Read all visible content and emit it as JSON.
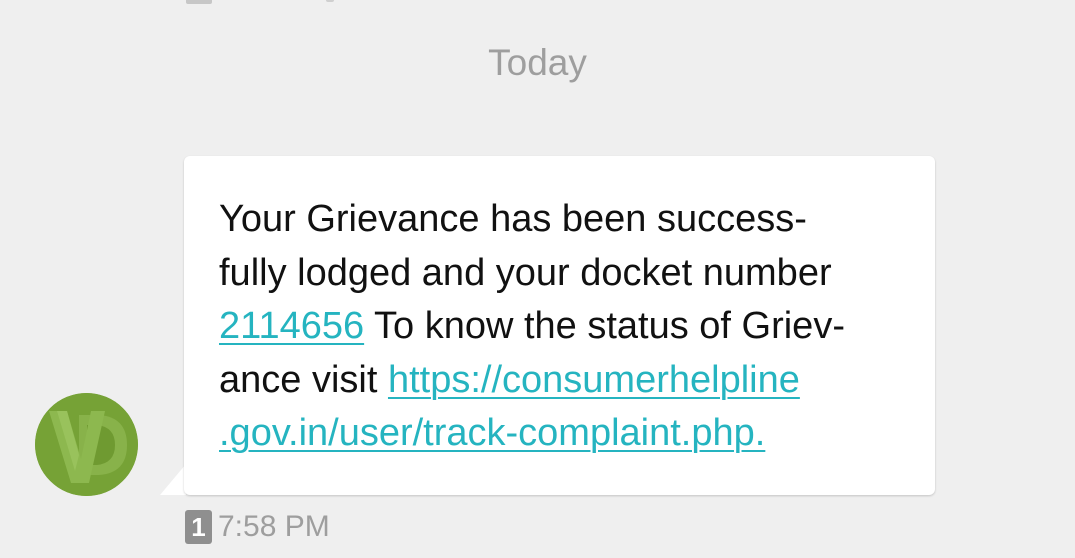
{
  "conversation": {
    "date_divider": "Today"
  },
  "message": {
    "text_line1": "Your Grievance has been success-",
    "text_line2": "fully lodged and your docket number",
    "docket_number": "2114656",
    "text_line3_rest": " To know the status of Griev-",
    "text_line4_prefix": "ance visit ",
    "link_part1": "https://consumerhelpline",
    "link_part2": ".gov.in/user/track-complaint.php.",
    "sim_slot": "1",
    "timestamp": "7:58 PM"
  },
  "sender": {
    "avatar_icon": "vd-logo-icon",
    "avatar_color": "#76a236"
  },
  "colors": {
    "background": "#efefef",
    "bubble": "#ffffff",
    "link": "#25b4c0",
    "muted_text": "#9e9e9e"
  }
}
